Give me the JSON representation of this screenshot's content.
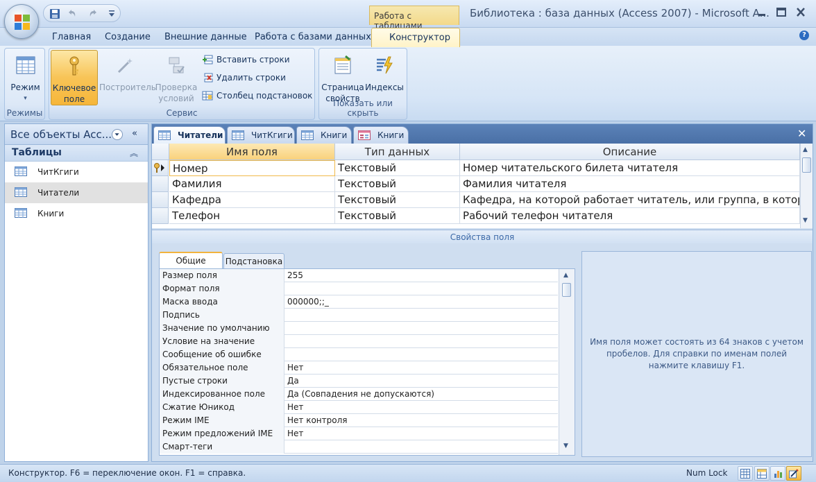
{
  "window": {
    "title": "Библиотека : база данных (Access 2007) - Microsoft A...",
    "context_tab": "Работа с таблицами"
  },
  "ribbon_tabs": [
    "Главная",
    "Создание",
    "Внешние данные",
    "Работа с базами данных",
    "Конструктор"
  ],
  "ribbon": {
    "groups": {
      "rezhimy": "Режимы",
      "servis": "Сервис",
      "pokazat": "Показать или скрыть"
    },
    "buttons": {
      "rezhim": "Режим",
      "key_field": "Ключевое\nполе",
      "builder": "Построитель",
      "check": "Проверка\nусловий",
      "insert_rows": "Вставить строки",
      "delete_rows": "Удалить строки",
      "lookup_column": "Столбец подстановок",
      "property_sheet": "Страница\nсвойств",
      "indexes": "Индексы"
    }
  },
  "nav": {
    "title": "Все объекты Acc...",
    "group": "Таблицы",
    "items": [
      "ЧитКгиги",
      "Читатели",
      "Книги"
    ],
    "selected_index": 1
  },
  "doc_tabs": [
    "Читатели",
    "ЧитКгиги",
    "Книги",
    "Книги"
  ],
  "field_grid": {
    "headers": [
      "Имя поля",
      "Тип данных",
      "Описание"
    ],
    "rows": [
      [
        "Номер",
        "Текстовый",
        "Номер читательского билета читателя"
      ],
      [
        "Фамилия",
        "Текстовый",
        "Фамилия читателя"
      ],
      [
        "Кафедра",
        "Текстовый",
        "Кафедра, на которой работает читатель, или группа, в которой"
      ],
      [
        "Телефон",
        "Текстовый",
        "Рабочий телефон читателя"
      ]
    ]
  },
  "field_props_label": "Свойства поля",
  "prop_tabs": [
    "Общие",
    "Подстановка"
  ],
  "properties": [
    {
      "name": "Размер поля",
      "value": "255"
    },
    {
      "name": "Формат поля",
      "value": ""
    },
    {
      "name": "Маска ввода",
      "value": "000000;;_"
    },
    {
      "name": "Подпись",
      "value": ""
    },
    {
      "name": "Значение по умолчанию",
      "value": ""
    },
    {
      "name": "Условие на значение",
      "value": ""
    },
    {
      "name": "Сообщение об ошибке",
      "value": ""
    },
    {
      "name": "Обязательное поле",
      "value": "Нет"
    },
    {
      "name": "Пустые строки",
      "value": "Да"
    },
    {
      "name": "Индексированное поле",
      "value": "Да (Совпадения не допускаются)"
    },
    {
      "name": "Сжатие Юникод",
      "value": "Нет"
    },
    {
      "name": "Режим IME",
      "value": "Нет контроля"
    },
    {
      "name": "Режим предложений IME",
      "value": "Нет"
    },
    {
      "name": "Смарт-теги",
      "value": ""
    }
  ],
  "help_text": "Имя поля может состоять из 64 знаков с учетом пробелов.  Для справки по именам полей нажмите клавишу F1.",
  "status": {
    "text": "Конструктор.  F6 = переключение окон.  F1 = справка.",
    "numlock": "Num Lock"
  }
}
